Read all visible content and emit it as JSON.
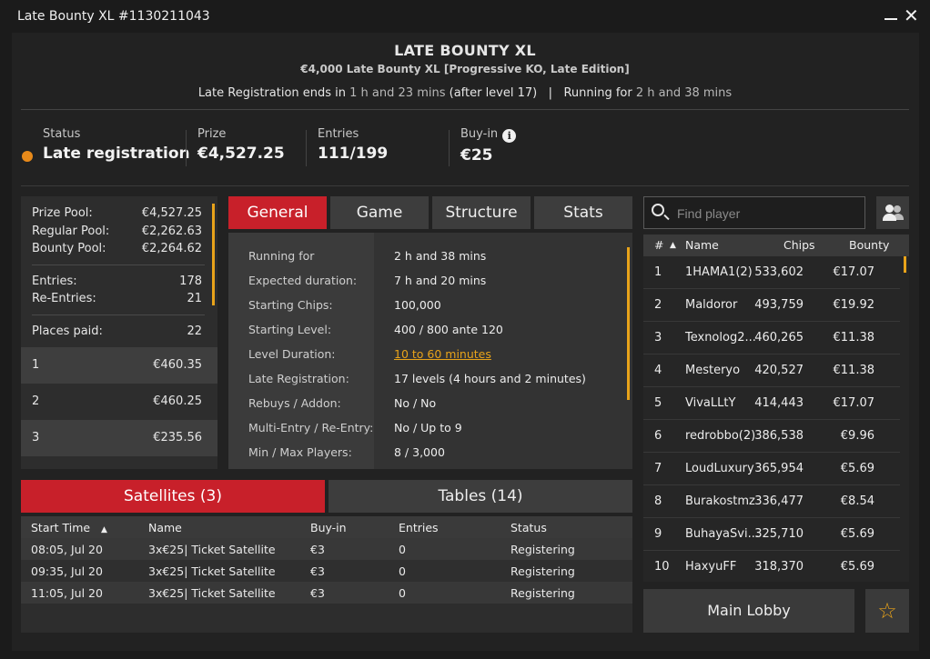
{
  "window": {
    "title": "Late Bounty XL #1130211043"
  },
  "header": {
    "name": "LATE BOUNTY XL",
    "subtitle": "€4,000 Late Bounty XL [Progressive KO, Late Edition]",
    "late_reg_prefix": "Late Registration ends in ",
    "late_reg_time": "1 h and 23 mins",
    "late_reg_suffix": " (after level 17)",
    "separator": "|",
    "running_prefix": "Running for ",
    "running_time": "2 h and 38 mins"
  },
  "stats": {
    "status_label": "Status",
    "status_value": "Late registration",
    "status_color": "#e88a1a",
    "prize_label": "Prize",
    "prize_value": "€4,527.25",
    "entries_label": "Entries",
    "entries_value": "111/199",
    "buyin_label": "Buy-in",
    "buyin_value": "€25",
    "info_glyph": "i"
  },
  "prize_pool": {
    "prize_pool_label": "Prize Pool:",
    "prize_pool_value": "€4,527.25",
    "regular_label": "Regular Pool:",
    "regular_value": "€2,262.63",
    "bounty_label": "Bounty Pool:",
    "bounty_value": "€2,264.62",
    "entries_label": "Entries:",
    "entries_value": "178",
    "reentries_label": "Re-Entries:",
    "reentries_value": "21",
    "places_label": "Places paid:",
    "places_value": "22",
    "places": [
      {
        "place": "1",
        "amount": "€460.35"
      },
      {
        "place": "2",
        "amount": "€460.25"
      },
      {
        "place": "3",
        "amount": "€235.56"
      }
    ]
  },
  "tabs": [
    "General",
    "Game",
    "Structure",
    "Stats"
  ],
  "general": [
    {
      "k": "Running for",
      "v": "2 h and 38 mins"
    },
    {
      "k": "Expected duration:",
      "v": "7 h and 20 mins"
    },
    {
      "k": "Starting Chips:",
      "v": "100,000"
    },
    {
      "k": "Starting Level:",
      "v": "400 / 800 ante 120"
    },
    {
      "k": "Level Duration:",
      "v": "10 to 60 minutes"
    },
    {
      "k": "Late Registration:",
      "v": "17 levels (4 hours and 2 minutes)"
    },
    {
      "k": "Rebuys / Addon:",
      "v": "No / No"
    },
    {
      "k": "Multi-Entry / Re-Entry:",
      "v": "No / Up to 9"
    },
    {
      "k": "Min / Max Players:",
      "v": "8 / 3,000"
    }
  ],
  "bottom_tabs": {
    "satellites": "Satellites (3)",
    "tables": "Tables (14)"
  },
  "satellites": {
    "headers": {
      "start": "Start Time",
      "sort_icon": "▲",
      "name": "Name",
      "buyin": "Buy-in",
      "entries": "Entries",
      "status": "Status"
    },
    "rows": [
      {
        "start": "08:05, Jul 20",
        "name": "3x€25| Ticket Satellite",
        "buyin": "€3",
        "entries": "0",
        "status": "Registering"
      },
      {
        "start": "09:35, Jul 20",
        "name": "3x€25| Ticket Satellite",
        "buyin": "€3",
        "entries": "0",
        "status": "Registering"
      },
      {
        "start": "11:05, Jul 20",
        "name": "3x€25| Ticket Satellite",
        "buyin": "€3",
        "entries": "0",
        "status": "Registering"
      }
    ]
  },
  "search": {
    "placeholder": "Find player"
  },
  "players": {
    "headers": {
      "rank": "#",
      "sort_icon": "▲",
      "name": "Name",
      "chips": "Chips",
      "bounty": "Bounty"
    },
    "rows": [
      {
        "rank": "1",
        "name": "1HAMA1(2)",
        "chips": "533,602",
        "bounty": "€17.07"
      },
      {
        "rank": "2",
        "name": "Maldoror",
        "chips": "493,759",
        "bounty": "€19.92"
      },
      {
        "rank": "3",
        "name": "Texnolog2...",
        "chips": "460,265",
        "bounty": "€11.38"
      },
      {
        "rank": "4",
        "name": "Mesteryo",
        "chips": "420,527",
        "bounty": "€11.38"
      },
      {
        "rank": "5",
        "name": "VivaLLtY",
        "chips": "414,443",
        "bounty": "€17.07"
      },
      {
        "rank": "6",
        "name": "redrobbo(2)",
        "chips": "386,538",
        "bounty": "€9.96"
      },
      {
        "rank": "7",
        "name": "LoudLuxury",
        "chips": "365,954",
        "bounty": "€5.69"
      },
      {
        "rank": "8",
        "name": "Burakostmz",
        "chips": "336,477",
        "bounty": "€8.54"
      },
      {
        "rank": "9",
        "name": "BuhayaSvi...",
        "chips": "325,710",
        "bounty": "€5.69"
      },
      {
        "rank": "10",
        "name": "HaxyuFF",
        "chips": "318,370",
        "bounty": "€5.69"
      }
    ]
  },
  "footer": {
    "main_lobby": "Main Lobby",
    "star_glyph": "☆"
  },
  "colors": {
    "accent_red": "#c8202a",
    "accent_orange": "#e8a31a"
  }
}
